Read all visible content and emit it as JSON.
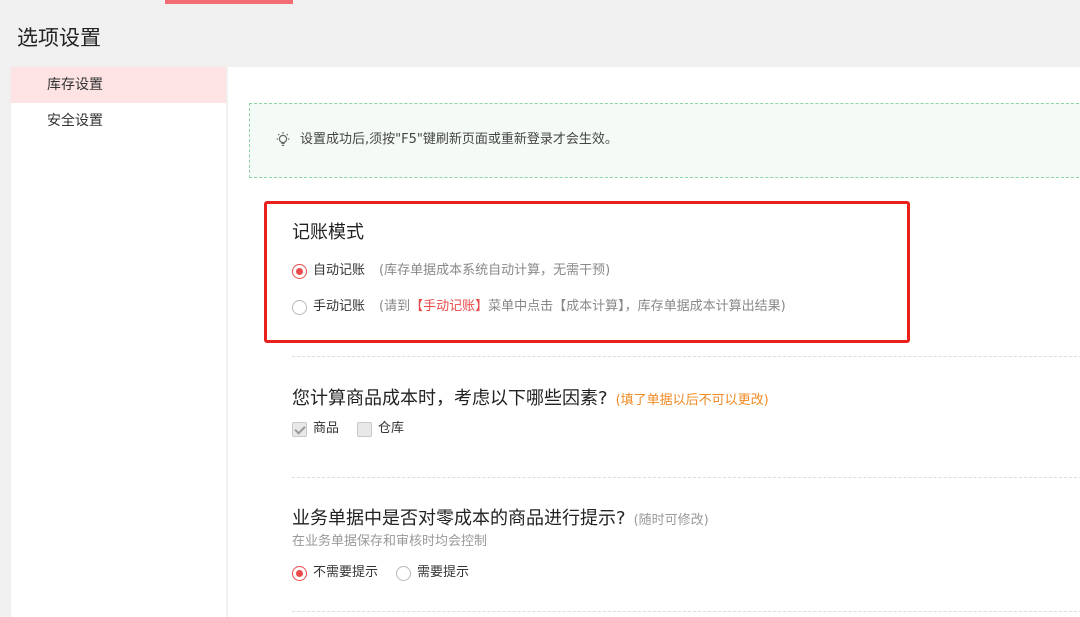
{
  "page": {
    "title": "选项设置"
  },
  "sidebar": {
    "items": [
      {
        "label": "库存设置",
        "active": true
      },
      {
        "label": "安全设置",
        "active": false
      }
    ]
  },
  "tip": {
    "text": "设置成功后,须按\"F5\"键刷新页面或重新登录才会生效。"
  },
  "accounting": {
    "title": "记账模式",
    "auto": {
      "label": "自动记账",
      "desc": "(库存单据成本系统自动计算，无需干预)"
    },
    "manual": {
      "label": "手动记账",
      "desc_pre": "(请到",
      "desc_hl": "【手动记账】",
      "desc_post": "菜单中点击【成本计算】，库存单据成本计算出结果)"
    }
  },
  "cost_factors": {
    "title": "您计算商品成本时，考虑以下哪些因素?",
    "note": "(填了单据以后不可以更改)",
    "options": [
      {
        "label": "商品",
        "checked": true
      },
      {
        "label": "仓库",
        "checked": false
      }
    ]
  },
  "zero_cost": {
    "title": "业务单据中是否对零成本的商品进行提示?",
    "note": "(随时可修改)",
    "sub": "在业务单据保存和审核时均会控制",
    "options": [
      {
        "label": "不需要提示",
        "checked": true
      },
      {
        "label": "需要提示",
        "checked": false
      }
    ]
  },
  "colors": {
    "accent": "#e94b4b",
    "highlight": "#e8211d",
    "active_bg": "#fde3e4",
    "tip_border": "#8fd4a6"
  }
}
